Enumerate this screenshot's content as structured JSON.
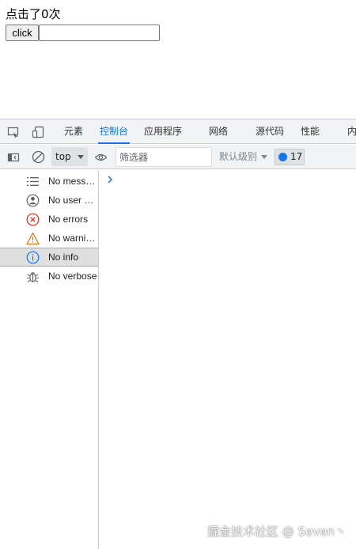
{
  "page": {
    "counter_text": "点击了0次",
    "click_button_label": "click",
    "text_input_value": ""
  },
  "devtools": {
    "tabs": [
      {
        "label": "元素",
        "active": false
      },
      {
        "label": "控制台",
        "active": true
      },
      {
        "label": "应用程序",
        "active": false
      },
      {
        "label": "网络",
        "active": false
      },
      {
        "label": "源代码",
        "active": false
      },
      {
        "label": "性能",
        "active": false
      },
      {
        "label": "内",
        "active": false
      }
    ],
    "toolbar": {
      "context_value": "top",
      "filter_placeholder": "筛选器",
      "level_label": "默认级别",
      "issues_count": "17"
    },
    "sidebar": {
      "items": [
        {
          "label": "No mess…",
          "icon": "list-icon",
          "selected": false
        },
        {
          "label": "No user …",
          "icon": "user-icon",
          "selected": false
        },
        {
          "label": "No errors",
          "icon": "error-icon",
          "selected": false
        },
        {
          "label": "No warni…",
          "icon": "warning-icon",
          "selected": false
        },
        {
          "label": "No info",
          "icon": "info-icon",
          "selected": true
        },
        {
          "label": "No verbose",
          "icon": "bug-icon",
          "selected": false
        }
      ]
    }
  },
  "colors": {
    "accent": "#1a73e8",
    "error": "#d93025",
    "warning": "#e37400"
  },
  "watermark": "掘金技术社区 @ Seven丶"
}
